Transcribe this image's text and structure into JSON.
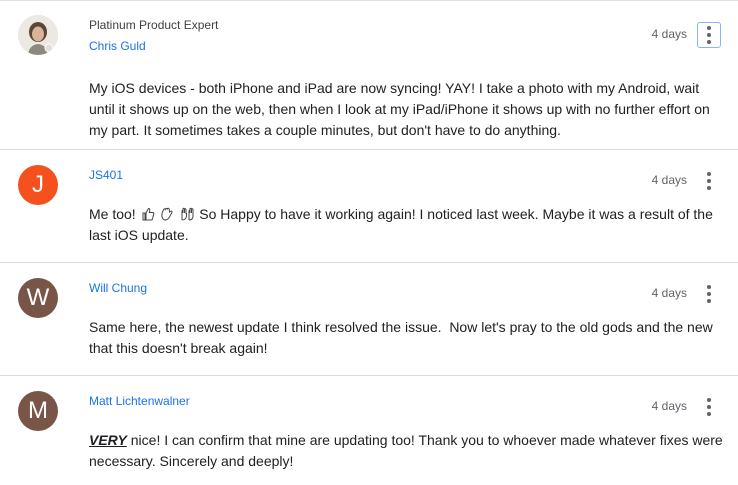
{
  "replies": [
    {
      "role": "Platinum Product Expert",
      "author": "Chris Guld",
      "time": "4 days",
      "avatar": {
        "type": "photo",
        "color": "#e8e4de"
      },
      "body": "My iOS devices - both iPhone and iPad are now syncing! YAY! I take a photo with my Android, wait until it shows up on the web, then when I look at my iPad/iPhone it shows up with no further effort on my part. It sometimes takes a couple minutes, but don't have to do anything."
    },
    {
      "author": "JS401",
      "time": "4 days",
      "avatar": {
        "letter": "J",
        "color": "#f4511e"
      },
      "body_prefix": "Me too!",
      "emojis": [
        "thumbs-up-icon",
        "clapping-hands-icon",
        "raised-hands-icon"
      ],
      "body_suffix": "So Happy to have it working again! I noticed last week. Maybe it was a result of the last iOS update."
    },
    {
      "author": "Will Chung",
      "time": "4 days",
      "avatar": {
        "letter": "W",
        "color": "#795548"
      },
      "body": "Same here, the newest update I think resolved the issue.  Now let's pray to the old gods and the new that this doesn't break again!"
    },
    {
      "author": "Matt Lichtenwalner",
      "time": "4 days",
      "avatar": {
        "letter": "M",
        "color": "#795548"
      },
      "body_emphasis": "VERY",
      "body_rest": " nice! I can confirm that mine are updating too! Thank you to whoever made whatever fixes were necessary. Sincerely and deeply!"
    }
  ],
  "colors": {
    "link": "#1a73e8",
    "text": "#202124",
    "muted": "#5f6368",
    "divider": "#dadce0"
  }
}
